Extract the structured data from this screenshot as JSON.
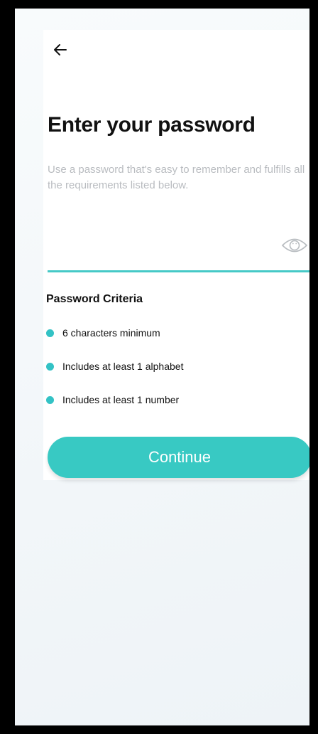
{
  "header": {
    "back_icon": "arrow-left-icon"
  },
  "title": "Enter your password",
  "subtitle": "Use a password that's easy to remember and fulfills all the requirements listed below.",
  "password_field": {
    "value": "",
    "toggle_icon": "eye-icon"
  },
  "criteria": {
    "title": "Password Criteria",
    "items": [
      {
        "label": "6 characters minimum"
      },
      {
        "label": "Includes at least 1 alphabet"
      },
      {
        "label": "Includes at least 1 number"
      }
    ]
  },
  "continue_label": "Continue",
  "colors": {
    "accent": "#38c9c3",
    "underline": "#46c9c7",
    "dot": "#33c2c5",
    "subtitle": "#b9bcc0"
  }
}
